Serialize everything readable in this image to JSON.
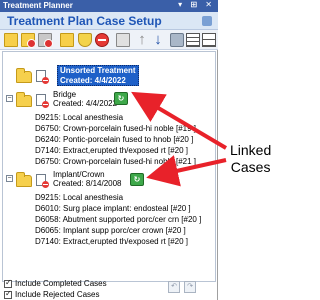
{
  "window": {
    "title": "Treatment Planner",
    "controls": "▾ ⊞ ✕"
  },
  "header": {
    "title": "Treatment Plan Case Setup"
  },
  "toolbar": {
    "icons": [
      "new-case-icon",
      "open-case-icon",
      "delete-case-icon",
      "shield-icon",
      "no-entry-icon",
      "lock-icon",
      "move-up-icon",
      "move-down-icon",
      "print-icon",
      "grid-icon",
      "list-icon"
    ]
  },
  "cases": {
    "unsorted": {
      "line1": "Unsorted Treatment",
      "line2": "Created: 4/4/2022"
    },
    "bridge": {
      "name": "Bridge",
      "created": "Created: 4/4/2022",
      "procedures": [
        "D9215: Local anesthesia",
        "D6750: Crown-porcelain fused-hi noble [#19 ]",
        "D6240: Pontic-porcelain fused to hnob [#20 ]",
        "D7140: Extract,erupted th/exposed rt [#20 ]",
        "D6750: Crown-porcelain fused-hi noble [#21 ]"
      ]
    },
    "implant": {
      "name": "Implant/Crown",
      "created": "Created: 8/14/2008",
      "procedures": [
        "D9215: Local anesthesia",
        "D6010: Surg place implant: endosteal [#20 ]",
        "D6058: Abutment supported porc/cer crn [#20 ]",
        "D6065: Implant supp porc/cer crown [#20 ]",
        "D7140: Extract,erupted th/exposed rt [#20 ]"
      ]
    }
  },
  "footer": {
    "include_completed": "Include Completed Cases",
    "include_rejected": "Include Rejected Cases"
  },
  "annotation": {
    "line1": "Linked",
    "line2": "Cases",
    "color": "#e8222a"
  }
}
